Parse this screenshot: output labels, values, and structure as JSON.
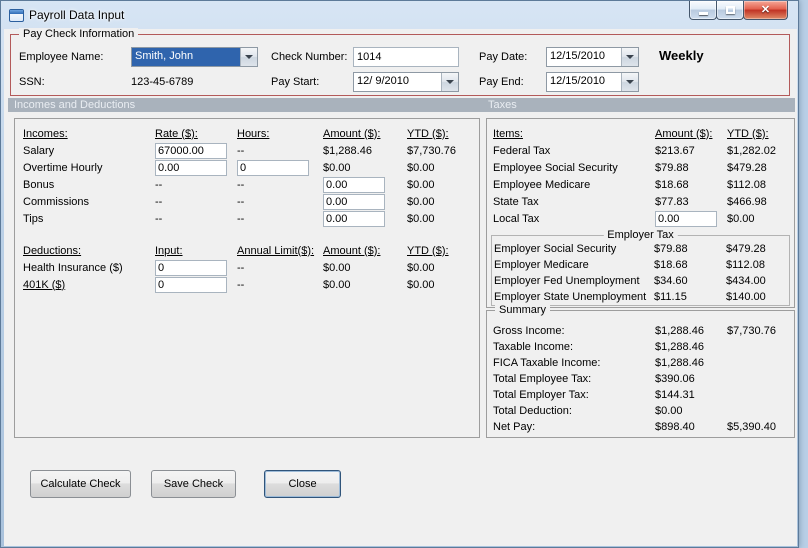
{
  "window": {
    "title": "Payroll Data Input"
  },
  "icons": {
    "close": "✕"
  },
  "colors": {
    "desktop": "#b9cfe6",
    "paycheck_group_border": "#b35a5a",
    "section_band": "#a9b2bc",
    "combo_selection": "#2f64ad",
    "close_button_red": "#c03224"
  },
  "paycheck": {
    "group_title": "Pay Check Information",
    "employee_name": {
      "label": "Employee Name:",
      "value": "Smith, John"
    },
    "ssn": {
      "label": "SSN:",
      "value": "123-45-6789"
    },
    "check_number": {
      "label": "Check Number:",
      "value": "1014"
    },
    "pay_start": {
      "label": "Pay Start:",
      "value": "12/ 9/2010"
    },
    "pay_date": {
      "label": "Pay Date:",
      "value": "12/15/2010"
    },
    "pay_end": {
      "label": "Pay End:",
      "value": "12/15/2010"
    },
    "frequency": "Weekly"
  },
  "section_headers": {
    "incomes_deductions": "Incomes and Deductions",
    "taxes": "Taxes"
  },
  "incomes": {
    "headers": {
      "name": "Incomes:",
      "rate": "Rate ($):",
      "hours": "Hours:",
      "amount": "Amount ($):",
      "ytd": "YTD ($):"
    },
    "rows": [
      {
        "name": "Salary",
        "rate": "67000.00",
        "hours": "--",
        "amount": "$1,288.46",
        "ytd": "$7,730.76"
      },
      {
        "name": "Overtime Hourly",
        "rate": "0.00",
        "hours": "0",
        "amount": "$0.00",
        "ytd": "$0.00"
      },
      {
        "name": "Bonus",
        "rate": "--",
        "hours": "--",
        "amount": "0.00",
        "ytd": "$0.00"
      },
      {
        "name": "Commissions",
        "rate": "--",
        "hours": "--",
        "amount": "0.00",
        "ytd": "$0.00"
      },
      {
        "name": "Tips",
        "rate": "--",
        "hours": "--",
        "amount": "0.00",
        "ytd": "$0.00"
      }
    ]
  },
  "deductions": {
    "headers": {
      "name": "Deductions:",
      "input": "Input:",
      "annual_limit": "Annual Limit($):",
      "amount": "Amount ($):",
      "ytd": "YTD ($):"
    },
    "rows": [
      {
        "name": "Health Insurance ($)",
        "input": "0",
        "annual_limit": "--",
        "amount": "$0.00",
        "ytd": "$0.00"
      },
      {
        "name": "401K ($)",
        "input": "0",
        "annual_limit": "--",
        "amount": "$0.00",
        "ytd": "$0.00"
      }
    ]
  },
  "taxes": {
    "headers": {
      "item": "Items:",
      "amount": "Amount ($):",
      "ytd": "YTD ($):"
    },
    "rows": [
      {
        "item": "Federal Tax",
        "amount": "$213.67",
        "ytd": "$1,282.02"
      },
      {
        "item": "Employee Social Security",
        "amount": "$79.88",
        "ytd": "$479.28"
      },
      {
        "item": "Employee Medicare",
        "amount": "$18.68",
        "ytd": "$112.08"
      },
      {
        "item": "State Tax",
        "amount": "$77.83",
        "ytd": "$466.98"
      },
      {
        "item": "Local Tax",
        "amount": "0.00",
        "ytd": "$0.00"
      }
    ],
    "employer_group_title": "Employer Tax",
    "employer_rows": [
      {
        "item": "Employer Social Security",
        "amount": "$79.88",
        "ytd": "$479.28"
      },
      {
        "item": "Employer Medicare",
        "amount": "$18.68",
        "ytd": "$112.08"
      },
      {
        "item": "Employer Fed Unemployment",
        "amount": "$34.60",
        "ytd": "$434.00"
      },
      {
        "item": "Employer State Unemployment",
        "amount": "$11.15",
        "ytd": "$140.00"
      }
    ]
  },
  "summary": {
    "group_title": "Summary",
    "rows": [
      {
        "label": "Gross Income:",
        "amount": "$1,288.46",
        "ytd": "$7,730.76"
      },
      {
        "label": "Taxable Income:",
        "amount": "$1,288.46",
        "ytd": ""
      },
      {
        "label": "FICA Taxable Income:",
        "amount": "$1,288.46",
        "ytd": ""
      },
      {
        "label": "Total Employee Tax:",
        "amount": "$390.06",
        "ytd": ""
      },
      {
        "label": "Total Employer Tax:",
        "amount": "$144.31",
        "ytd": ""
      },
      {
        "label": "Total Deduction:",
        "amount": "$0.00",
        "ytd": ""
      },
      {
        "label": "Net Pay:",
        "amount": "$898.40",
        "ytd": "$5,390.40"
      }
    ]
  },
  "buttons": {
    "calculate": "Calculate Check",
    "save": "Save Check",
    "close": "Close"
  }
}
